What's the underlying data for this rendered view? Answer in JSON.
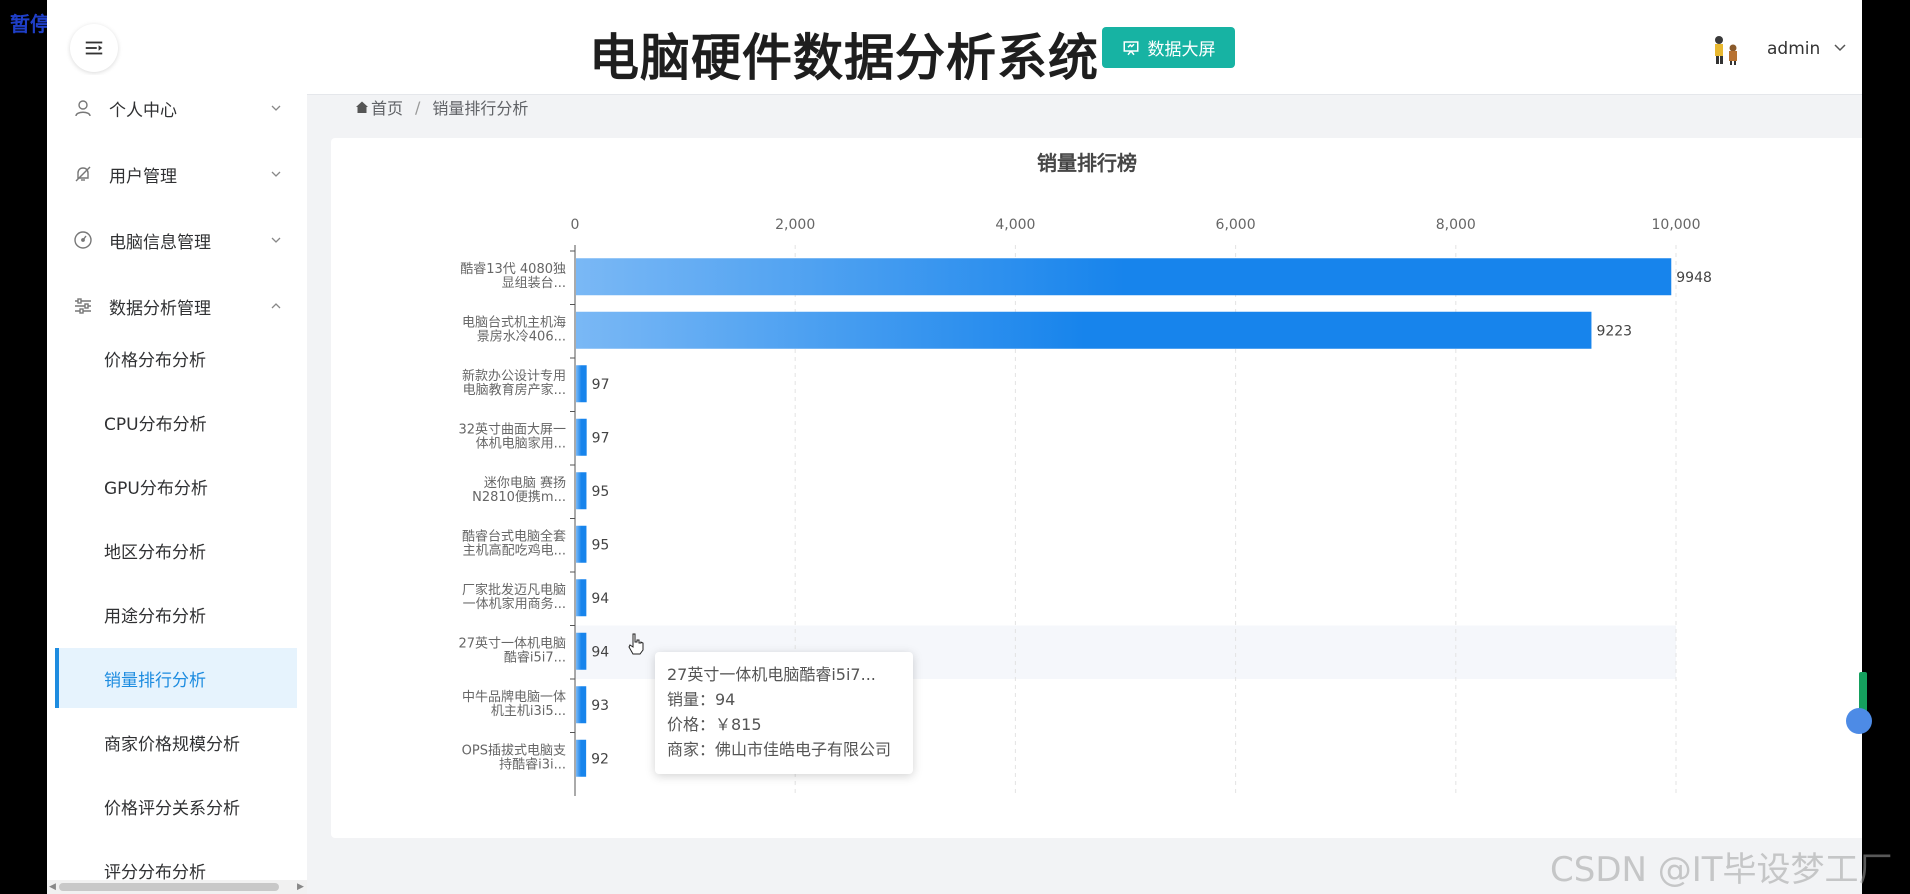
{
  "overlay": {
    "pause_label": "暂停"
  },
  "header": {
    "title": "电脑硬件数据分析系统",
    "screen_button_label": "数据大屏",
    "user_name": "admin"
  },
  "sidebar": {
    "menus": [
      {
        "label": "个人中心",
        "icon": "user-icon",
        "expanded": false
      },
      {
        "label": "用户管理",
        "icon": "bell-off-icon",
        "expanded": false
      },
      {
        "label": "电脑信息管理",
        "icon": "gauge-icon",
        "expanded": false
      },
      {
        "label": "数据分析管理",
        "icon": "sliders-icon",
        "expanded": true
      }
    ],
    "sub_items": [
      {
        "label": "价格分布分析"
      },
      {
        "label": "CPU分布分析"
      },
      {
        "label": "GPU分布分析"
      },
      {
        "label": "地区分布分析"
      },
      {
        "label": "用途分布分析"
      },
      {
        "label": "销量排行分析",
        "active": true
      },
      {
        "label": "商家价格规模分析"
      },
      {
        "label": "价格评分关系分析"
      },
      {
        "label": "评分分布分析"
      }
    ]
  },
  "breadcrumb": {
    "home": "首页",
    "separator": "/",
    "current": "销量排行分析"
  },
  "chart_data": {
    "type": "bar",
    "orientation": "horizontal",
    "title": "销量排行榜",
    "xlim": [
      0,
      10000
    ],
    "x_ticks": [
      "0",
      "2,000",
      "4,000",
      "6,000",
      "8,000",
      "10,000"
    ],
    "categories": [
      [
        "酷睿13代 4080独",
        "显组装台..."
      ],
      [
        "电脑台式机主机海",
        "景房水冷406..."
      ],
      [
        "新款办公设计专用",
        "电脑教育房产家..."
      ],
      [
        "32英寸曲面大屏一",
        "体机电脑家用..."
      ],
      [
        "迷你电脑 赛扬",
        "N2810便携m..."
      ],
      [
        "酷睿台式电脑全套",
        "主机高配吃鸡电..."
      ],
      [
        "厂家批发迈凡电脑",
        "一体机家用商务..."
      ],
      [
        "27英寸一体机电脑",
        "酷睿i5i7..."
      ],
      [
        "中牛品牌电脑一体",
        "机主机i3i5..."
      ],
      [
        "OPS插拔式电脑支",
        "持酷睿i3i..."
      ]
    ],
    "values": [
      9948,
      9223,
      97,
      97,
      95,
      95,
      94,
      94,
      93,
      92
    ],
    "highlight_index": 7,
    "grid": true,
    "bar_color_start": "#7ab8f5",
    "bar_color_end": "#1784ec"
  },
  "tooltip": {
    "name": "27英寸一体机电脑酷睿i5i7...",
    "sales_line": "销量：94",
    "price_line": "价格：￥815",
    "merchant_line": "商家：佛山市佳皓电子有限公司"
  },
  "watermark": "CSDN @IT毕设梦工厂"
}
